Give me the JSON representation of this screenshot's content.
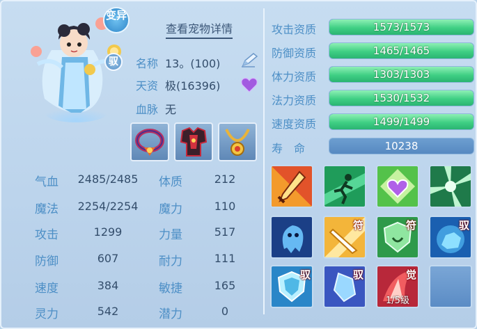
{
  "header": {
    "title": "查看宠物详情"
  },
  "portrait": {
    "tag_variant": "变异",
    "tag_tame": "驭"
  },
  "info": {
    "name_label": "名称",
    "name_value": "13。(100)",
    "talent_label": "天资",
    "talent_value": "极(16396)",
    "blood_label": "血脉",
    "blood_value": "无"
  },
  "equipment": [
    {
      "name": "necklace-collar-equip"
    },
    {
      "name": "armor-equip"
    },
    {
      "name": "gold-necklace-equip"
    }
  ],
  "stats": {
    "hp_label": "气血",
    "hp_value": "2485/2485",
    "mp_label": "魔法",
    "mp_value": "2254/2254",
    "atk_label": "攻击",
    "atk_value": "1299",
    "def_label": "防御",
    "def_value": "607",
    "spd_label": "速度",
    "spd_value": "384",
    "spi_label": "灵力",
    "spi_value": "542",
    "con_label": "体质",
    "con_value": "212",
    "mag_label": "魔力",
    "mag_value": "110",
    "str_label": "力量",
    "str_value": "517",
    "end_label": "耐力",
    "end_value": "111",
    "agi_label": "敏捷",
    "agi_value": "165",
    "pot_label": "潜力",
    "pot_value": "0"
  },
  "aptitudes": [
    {
      "label": "攻击资质",
      "text": "1573/1573",
      "fraction": 1.0
    },
    {
      "label": "防御资质",
      "text": "1465/1465",
      "fraction": 1.0
    },
    {
      "label": "体力资质",
      "text": "1303/1303",
      "fraction": 1.0
    },
    {
      "label": "法力资质",
      "text": "1530/1532",
      "fraction": 0.9987
    },
    {
      "label": "速度资质",
      "text": "1499/1499",
      "fraction": 1.0
    }
  ],
  "lifespan": {
    "label": "寿　命",
    "value": "10238"
  },
  "skills": [
    {
      "icon": "flaming-sword-skill-icon",
      "badge": "",
      "level": ""
    },
    {
      "icon": "running-figure-skill-icon",
      "badge": "",
      "level": ""
    },
    {
      "icon": "purple-heart-skill-icon",
      "badge": "",
      "level": ""
    },
    {
      "icon": "green-burst-skill-icon",
      "badge": "",
      "level": ""
    },
    {
      "icon": "ghost-spirit-skill-icon",
      "badge": "",
      "level": ""
    },
    {
      "icon": "golden-blade-skill-icon",
      "badge": "符",
      "level": ""
    },
    {
      "icon": "green-shield-skill-icon",
      "badge": "符",
      "level": ""
    },
    {
      "icon": "blue-beast-skill-icon",
      "badge": "驭",
      "level": ""
    },
    {
      "icon": "blue-shield-skill-icon",
      "badge": "驭",
      "level": ""
    },
    {
      "icon": "blue-crystal-skill-icon",
      "badge": "驭",
      "level": ""
    },
    {
      "icon": "red-awaken-skill-icon",
      "badge": "觉",
      "level": "1/5级"
    },
    {
      "icon": "empty-skill-slot",
      "badge": "",
      "level": ""
    }
  ]
}
